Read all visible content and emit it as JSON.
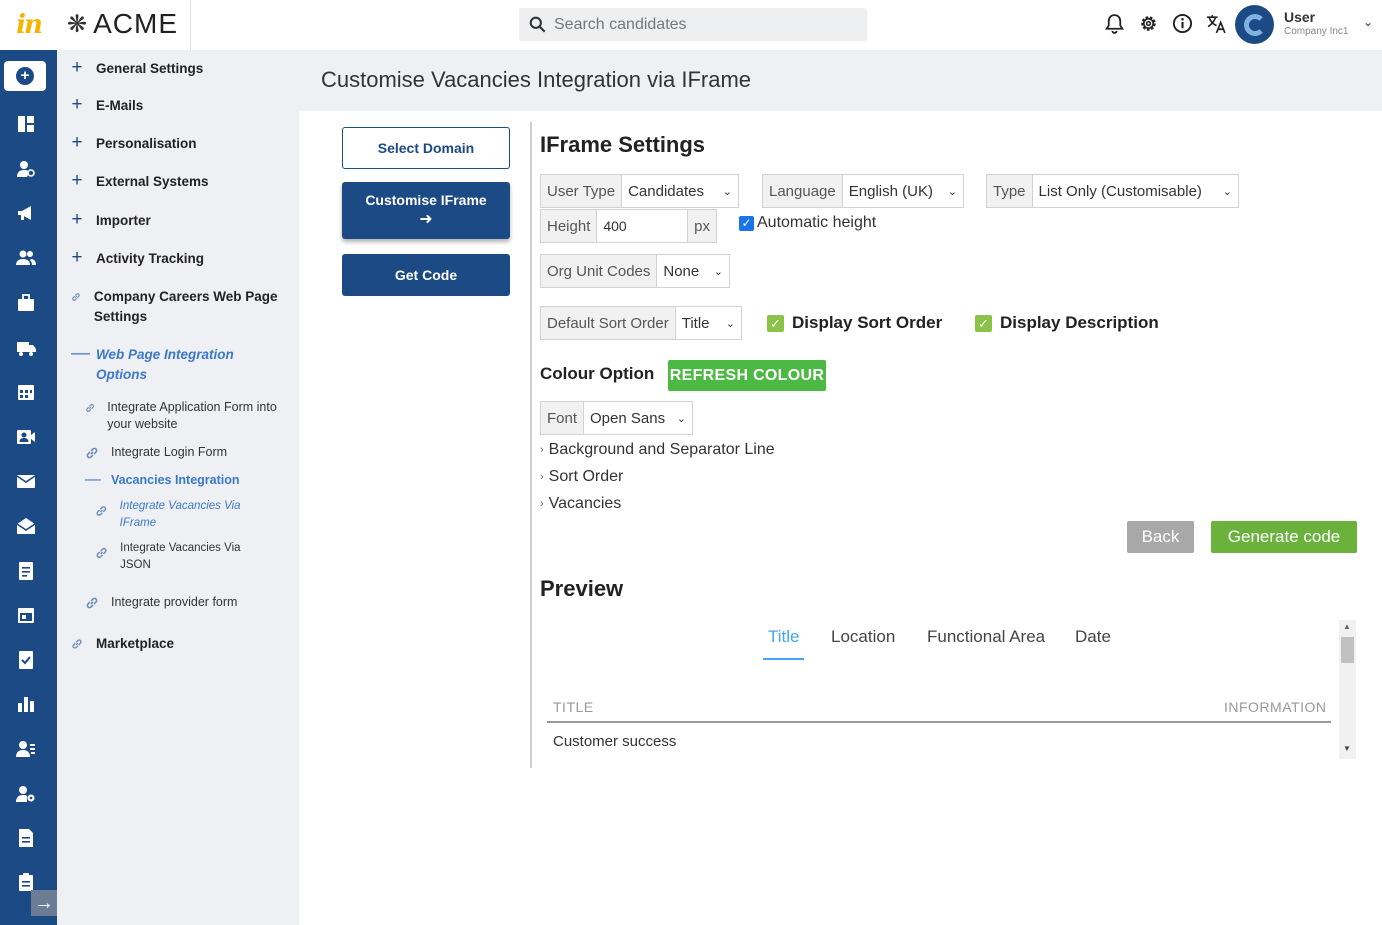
{
  "app": {
    "logo_text": "in",
    "brand_name": "ACME",
    "search_placeholder": "Search candidates",
    "user_name": "User",
    "user_company": "Company Inc1"
  },
  "sidebar": {
    "items": [
      {
        "label": "General Settings"
      },
      {
        "label": "E-Mails"
      },
      {
        "label": "Personalisation"
      },
      {
        "label": "External Systems"
      },
      {
        "label": "Importer"
      },
      {
        "label": "Activity Tracking"
      },
      {
        "label": "Company Careers Web Page Settings"
      },
      {
        "label": "Web Page Integration Options"
      },
      {
        "label": "Marketplace"
      }
    ],
    "sub_items": [
      {
        "label": "Integrate Application Form into your website"
      },
      {
        "label": "Integrate Login Form"
      },
      {
        "label": "Vacancies Integration"
      },
      {
        "label": "Integrate Vacancies Via IFrame"
      },
      {
        "label": "Integrate Vacancies Via JSON"
      },
      {
        "label": "Integrate provider form"
      }
    ]
  },
  "page": {
    "title": "Customise Vacancies Integration via IFrame"
  },
  "steps": {
    "select_domain": "Select Domain",
    "customise_iframe": "Customise IFrame",
    "get_code": "Get Code"
  },
  "settings": {
    "heading": "IFrame Settings",
    "user_type": {
      "label": "User Type",
      "value": "Candidates"
    },
    "language": {
      "label": "Language",
      "value": "English (UK)"
    },
    "type": {
      "label": "Type",
      "value": "List Only (Customisable)"
    },
    "height": {
      "label": "Height",
      "value": "400",
      "unit": "px"
    },
    "automatic_height": {
      "label": "Automatic height",
      "checked": true
    },
    "org_unit_codes": {
      "label": "Org Unit Codes",
      "value": "None"
    },
    "default_sort_order": {
      "label": "Default Sort Order",
      "value": "Title"
    },
    "display_sort_order": {
      "label": "Display Sort Order",
      "checked": true
    },
    "display_description": {
      "label": "Display Description",
      "checked": true
    }
  },
  "colour": {
    "heading": "Colour Option",
    "refresh_button": "REFRESH COLOUR",
    "font": {
      "label": "Font",
      "value": "Open Sans"
    },
    "sections": [
      "Background and Separator Line",
      "Sort Order",
      "Vacancies"
    ]
  },
  "actions": {
    "back": "Back",
    "generate": "Generate code"
  },
  "preview": {
    "heading": "Preview",
    "tabs": [
      "Title",
      "Location",
      "Functional Area",
      "Date"
    ],
    "active_tab": "Title",
    "columns": [
      "TITLE",
      "INFORMATION"
    ],
    "rows": [
      "Customer success"
    ]
  },
  "colors": {
    "navy": "#1c4a84",
    "accent_blue": "#3c78c9",
    "green": "#4cb944",
    "generate_green": "#6ab23c"
  }
}
